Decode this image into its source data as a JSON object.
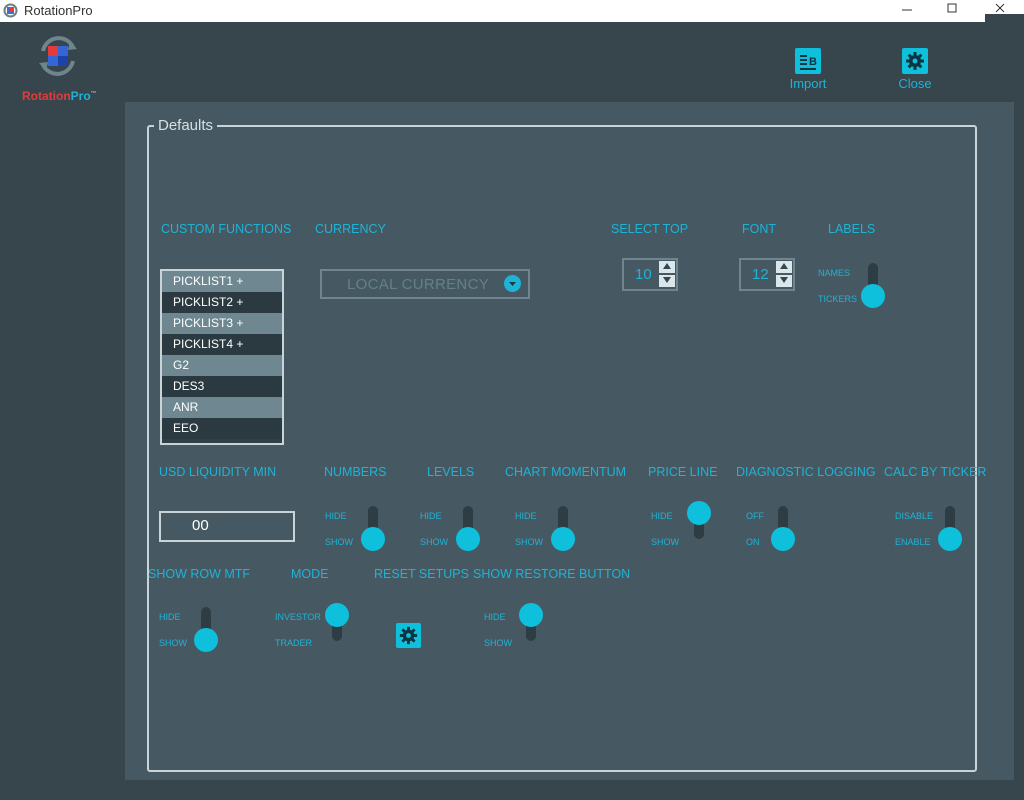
{
  "window": {
    "title": "RotationPro",
    "minimize": "─̲",
    "maximize": "☐",
    "close": "✕"
  },
  "logo": {
    "name_red": "Rotation",
    "name_blue": "Pro",
    "tm": "™"
  },
  "toolbar": {
    "import_label": "Import",
    "close_label": "Close"
  },
  "group": {
    "title": "Defaults"
  },
  "headers": {
    "custom_functions": "CUSTOM FUNCTIONS",
    "currency": "CURRENCY",
    "select_top": "SELECT TOP",
    "font": "FONT",
    "labels": "LABELS",
    "usd_liquidity_min": "USD LIQUIDITY MIN",
    "numbers": "NUMBERS",
    "levels": "LEVELS",
    "chart_momentum": "CHART MOMENTUM",
    "price_line": "PRICE LINE",
    "diagnostic_logging": "DIAGNOSTIC LOGGING",
    "calc_by_ticker": "CALC BY TICKER",
    "show_row_mtf": "SHOW ROW MTF",
    "mode": "MODE",
    "reset_setups": "RESET SETUPS",
    "show_restore_button": "SHOW RESTORE BUTTON"
  },
  "custom_functions": [
    "PICKLIST1 +",
    "PICKLIST2 +",
    "PICKLIST3 +",
    "PICKLIST4 +",
    "G2",
    "DES3",
    "ANR",
    "EEO"
  ],
  "currency": {
    "value": "LOCAL CURRENCY"
  },
  "select_top": {
    "value": "10"
  },
  "font": {
    "value": "12"
  },
  "toggles": {
    "labels": {
      "top": "NAMES",
      "bottom": "TICKERS",
      "selected": "bottom"
    },
    "numbers": {
      "top": "HIDE",
      "bottom": "SHOW",
      "selected": "bottom"
    },
    "levels": {
      "top": "HIDE",
      "bottom": "SHOW",
      "selected": "bottom"
    },
    "chart_momentum": {
      "top": "HIDE",
      "bottom": "SHOW",
      "selected": "bottom"
    },
    "price_line": {
      "top": "HIDE",
      "bottom": "SHOW",
      "selected": "top"
    },
    "diagnostic_logging": {
      "top": "OFF",
      "bottom": "ON",
      "selected": "bottom"
    },
    "calc_by_ticker": {
      "top": "DISABLE",
      "bottom": "ENABLE",
      "selected": "bottom"
    },
    "show_row_mtf": {
      "top": "HIDE",
      "bottom": "SHOW",
      "selected": "bottom"
    },
    "mode": {
      "top": "INVESTOR",
      "bottom": "TRADER",
      "selected": "top"
    },
    "show_restore_button": {
      "top": "HIDE",
      "bottom": "SHOW",
      "selected": "top"
    }
  },
  "usd_liquidity_min": {
    "value": "00"
  },
  "colors": {
    "accent": "#0ec0dc",
    "panel": "#465963",
    "background": "#37454d",
    "label": "#1eb3d6"
  }
}
